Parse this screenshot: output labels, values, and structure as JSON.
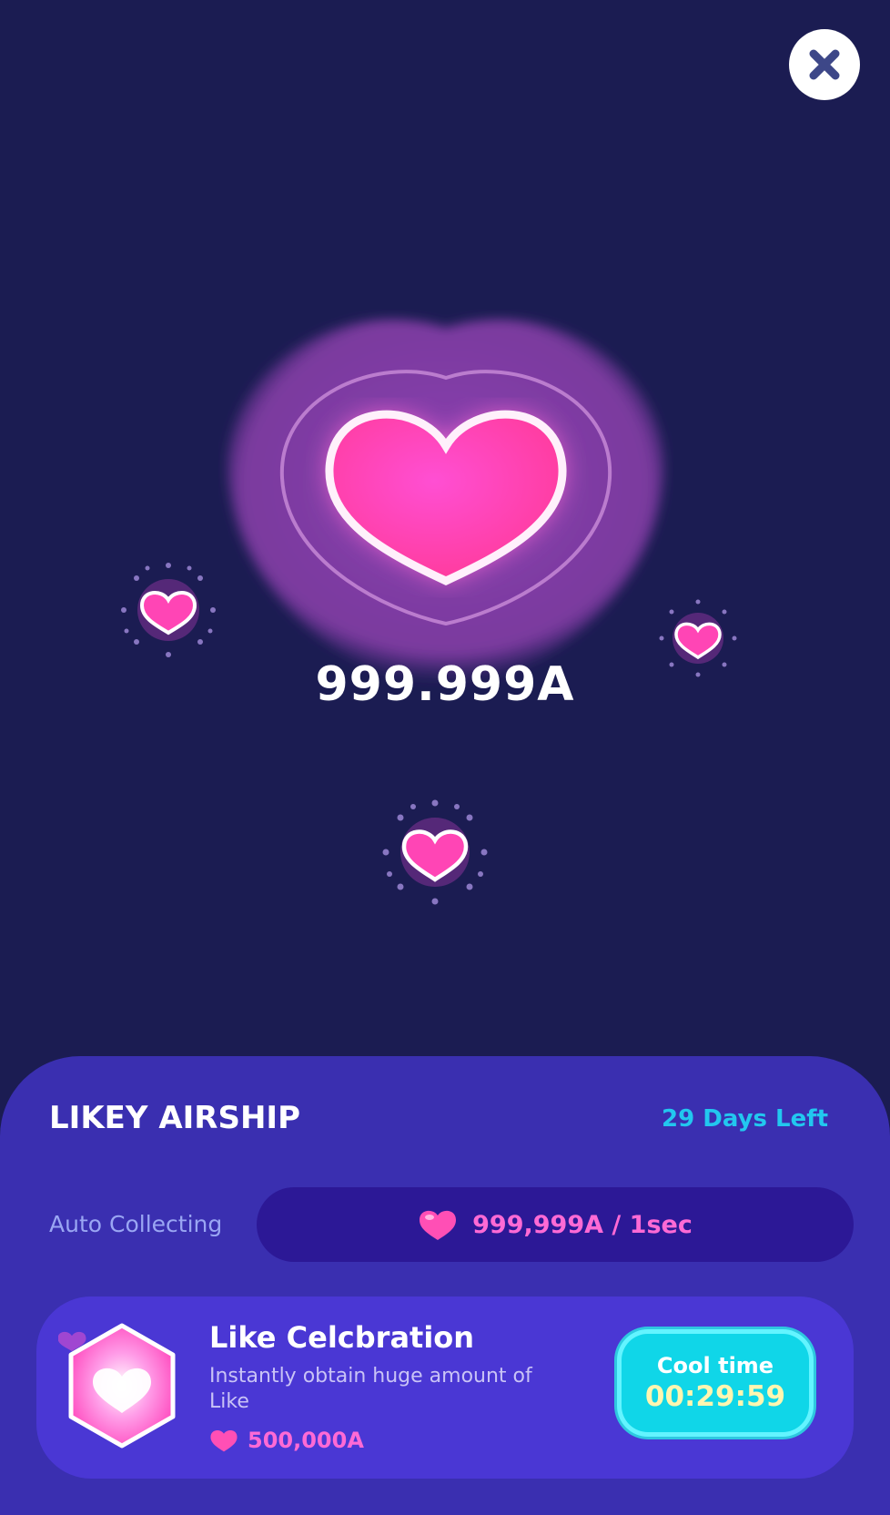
{
  "close": {
    "icon": "close-icon"
  },
  "hero": {
    "counter": "999.999A",
    "icon": "heart-icon"
  },
  "panel": {
    "title": "LIKEY AIRSHIP",
    "days_left": "29 Days Left",
    "auto_collect": {
      "label": "Auto Collecting",
      "rate": "999,999A / 1sec"
    },
    "card": {
      "title": "Like Celcbration",
      "description": "Instantly obtain huge amount of Like",
      "cost": "500,000A",
      "cool_label": "Cool time",
      "cool_value": "00:29:59"
    }
  },
  "colors": {
    "background": "#1b1c52",
    "panel": "#3a2fb0",
    "card": "#4a37d4",
    "pink": "#ff6ad5",
    "cyan": "#22c7ef"
  }
}
